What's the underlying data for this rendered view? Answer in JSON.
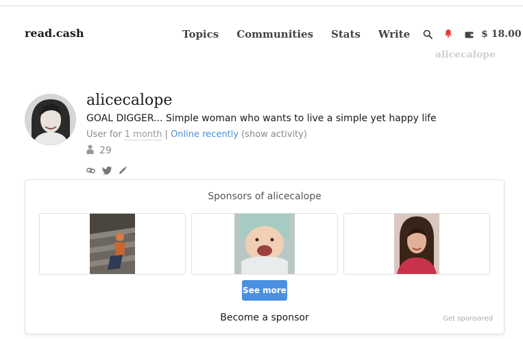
{
  "header": {
    "brand": "read.cash",
    "nav": [
      "Topics",
      "Communities",
      "Stats",
      "Write"
    ],
    "balance": "$ 18.00",
    "username": "alicecalope"
  },
  "profile": {
    "name": "alicecalope",
    "bio": "GOAL DIGGER... Simple woman who wants to live a simple yet happy life",
    "user_for_prefix": "User for ",
    "user_for_value": "1 month",
    "separator": " | ",
    "online": "Online recently",
    "show_activity": "(show activity)",
    "followers": "29"
  },
  "sponsors": {
    "title": "Sponsors of alicecalope",
    "see_more": "See more",
    "become": "Become a sponsor",
    "get_sponsored": "Get sponsored"
  },
  "colors": {
    "accent": "#4a90e2",
    "link": "#4a90d9",
    "notification": "#e53935"
  },
  "icons": [
    "search-icon",
    "bell-icon",
    "wallet-icon",
    "person-icon",
    "link-icon",
    "twitter-icon",
    "pencil-icon"
  ]
}
